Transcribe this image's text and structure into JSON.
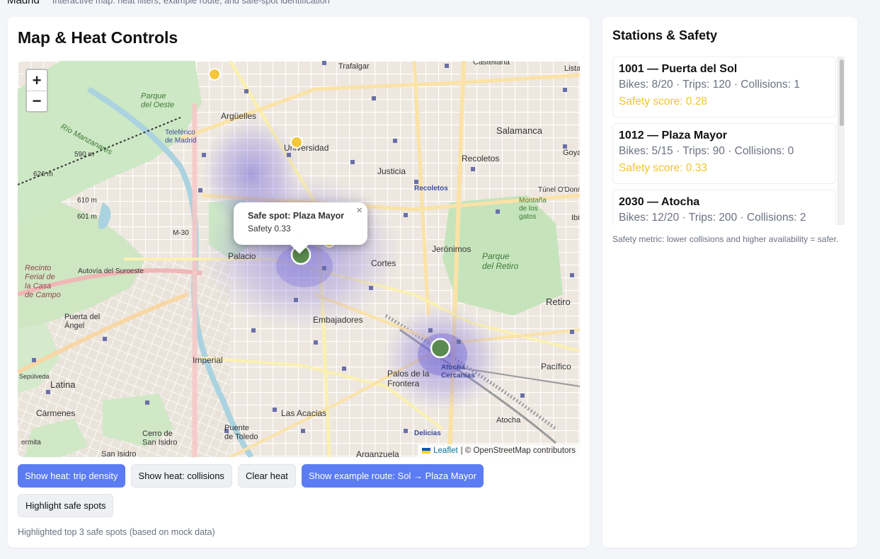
{
  "header": {
    "app_name": "Madrid",
    "subtitle": "Interactive map: heat filters, example route, and safe-spot identification"
  },
  "left_panel": {
    "title": "Map & Heat Controls",
    "zoom_in": "+",
    "zoom_out": "−",
    "popup": {
      "title": "Safe spot: Plaza Mayor",
      "value": "Safety 0.33",
      "close": "×"
    },
    "attribution": {
      "leaflet": "Leaflet",
      "osm": "| © OpenStreetMap contributors"
    },
    "map_labels": {
      "trafalgar": "Trafalgar",
      "castellana": "Castellana",
      "lista": "Lista",
      "parque_oeste": "Parque\ndel Oeste",
      "rio": "Río Manzanares",
      "arguelles": "Argüelles",
      "teleferico": "Teleférico\nde Madrid",
      "universidad": "Universidad",
      "justicia": "Justicia",
      "recoletos": "Recoletos",
      "recoletos_blue": "Recoletos",
      "salamanca": "Salamanca",
      "goya": "Goya",
      "tunel": "Túnel O'Donnell",
      "montana": "Montaña\nde los\ngatos",
      "ibiza": "Ibi",
      "h590": "590 m",
      "h626": "626 m",
      "h610": "610 m",
      "h601": "601 m",
      "m30": "M-30",
      "palacio": "Palacio",
      "jeronimos": "Jerónimos",
      "parque_retiro": "Parque\ndel Retiro",
      "cortes": "Cortes",
      "recinto": "Recinto\nFerial de\nla Casa\nde Campo",
      "autovia": "Autovía del Suroeste",
      "puerta_angel": "Puerta del\nÁngel",
      "embajadores": "Embajadores",
      "retiro": "Retiro",
      "imperial": "Imperial",
      "atocha_cerc": "Atocha\nCercanías",
      "palos": "Palos de la\nFrontera",
      "pacifico": "Pacífico",
      "latina": "Latina",
      "carmenes": "Cármenes",
      "las_acacias": "Las Acacias",
      "atocha": "Atocha",
      "cerro": "Cerro de\nSan Isidro",
      "puente_toledo": "Puente\nde Toledo",
      "delicias": "Delicias",
      "arganzuela": "Arganzuela",
      "san_isidro": "San Isidro",
      "sepulveda": "Sepúlveda",
      "ermita": "ermita"
    }
  },
  "buttons": {
    "heat_trip": "Show heat: trip density",
    "heat_collisions": "Show heat: collisions",
    "clear_heat": "Clear heat",
    "example_route": "Show example route: Sol → Plaza Mayor",
    "highlight_safe": "Highlight safe spots"
  },
  "status_text": "Highlighted top 3 safe spots (based on mock data)",
  "right_panel": {
    "title": "Stations & Safety",
    "stations": [
      {
        "name": "1001 — Puerta del Sol",
        "stats": "Bikes: 8/20  ·  Trips: 120  ·  Collisions: 1",
        "score": "Safety score: 0.28"
      },
      {
        "name": "1012 — Plaza Mayor",
        "stats": "Bikes: 5/15  ·  Trips: 90  ·  Collisions: 0",
        "score": "Safety score: 0.33"
      },
      {
        "name": "2030 — Atocha",
        "stats": "Bikes: 12/20  ·  Trips: 200  ·  Collisions: 2",
        "score": ""
      }
    ],
    "metric_note": "Safety metric: lower collisions and higher availability = safer."
  },
  "colors": {
    "primary": "#5b7cf2",
    "safe_marker": "#5a8a4f",
    "station_marker": "#f4c83a",
    "score_text": "#f3c52a",
    "heat": "#8a7fe0"
  }
}
